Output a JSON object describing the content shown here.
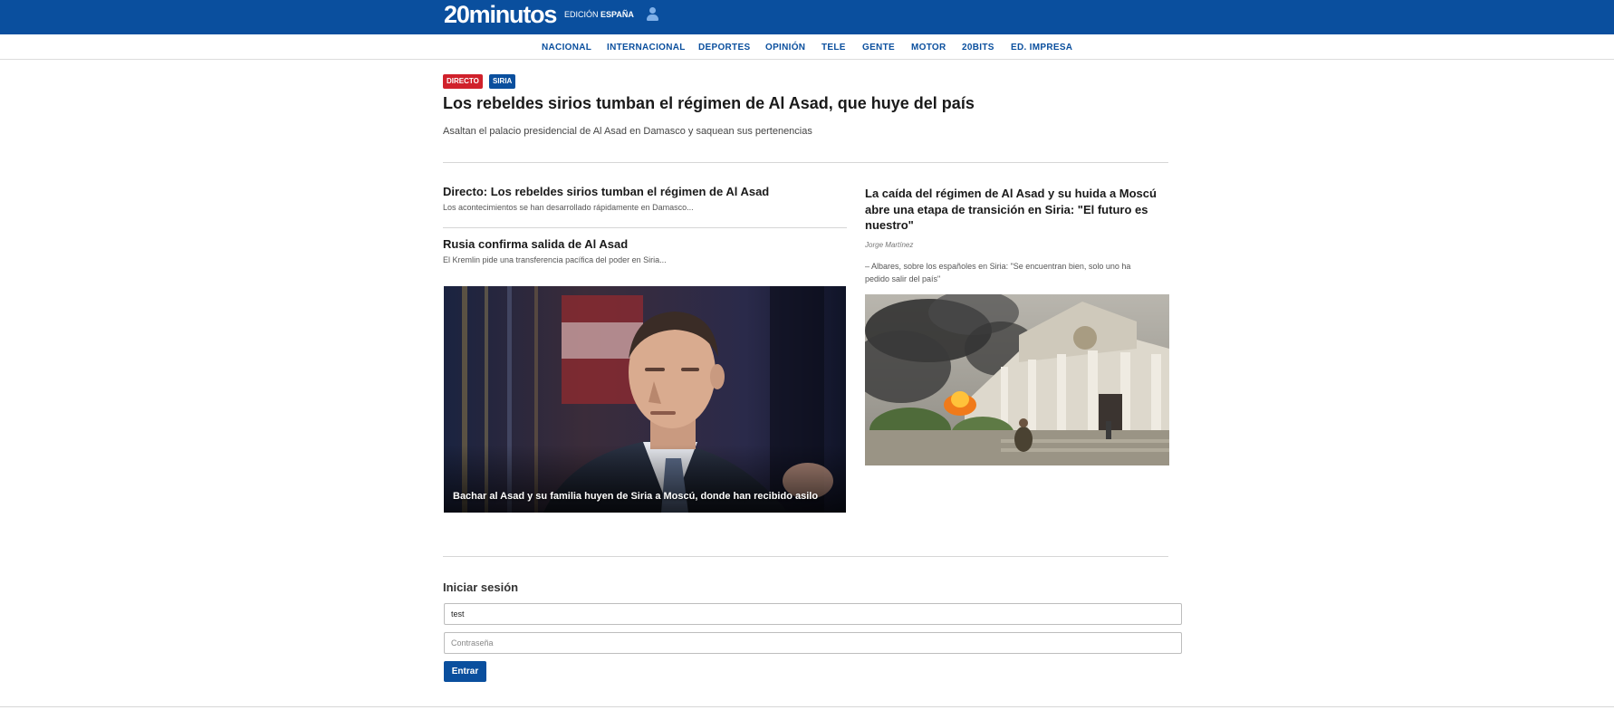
{
  "header": {
    "logo": "20minutos",
    "edition_label": "EDICIÓN",
    "edition_value": "ESPAÑA",
    "user_icon": "user-icon"
  },
  "nav": {
    "items": [
      "NACIONAL",
      "INTERNACIONAL",
      "DEPORTES",
      "OPINIÓN",
      "TELE",
      "GENTE",
      "MOTOR",
      "20BITS",
      "ED. IMPRESA"
    ]
  },
  "lead": {
    "tags": [
      "DIRECTO",
      "SIRIA"
    ],
    "title": "Los rebeldes sirios tumban el régimen de Al Asad, que huye del país",
    "summary": "Asaltan el palacio presidencial de Al Asad en Damasco y saquean sus pertenencias"
  },
  "left_column": {
    "stories": [
      {
        "title": "Directo: Los rebeldes sirios tumban el régimen de Al Asad",
        "summary": "Los acontecimientos se han desarrollado rápidamente en Damasco..."
      },
      {
        "title": "Rusia confirma salida de Al Asad",
        "summary": "El Kremlin pide una transferencia pacífica del poder en Siria..."
      }
    ],
    "photo_caption": "Bachar al Asad y su familia huyen de Siria a Moscú, donde han recibido asilo"
  },
  "right_column": {
    "title": "La caída del régimen de Al Asad y su huida a Moscú abre una etapa de transición en Siria: \"El futuro es nuestro\"",
    "author": "Jorge Martínez",
    "related": "– Albares, sobre los españoles en Siria: \"Se encuentran bien, solo uno ha pedido salir del país\""
  },
  "login": {
    "title": "Iniciar sesión",
    "username_value": "test",
    "password_placeholder": "Contraseña",
    "submit_label": "Entrar"
  },
  "colors": {
    "brand": "#0a4f9e",
    "tag_red": "#d0212b"
  }
}
